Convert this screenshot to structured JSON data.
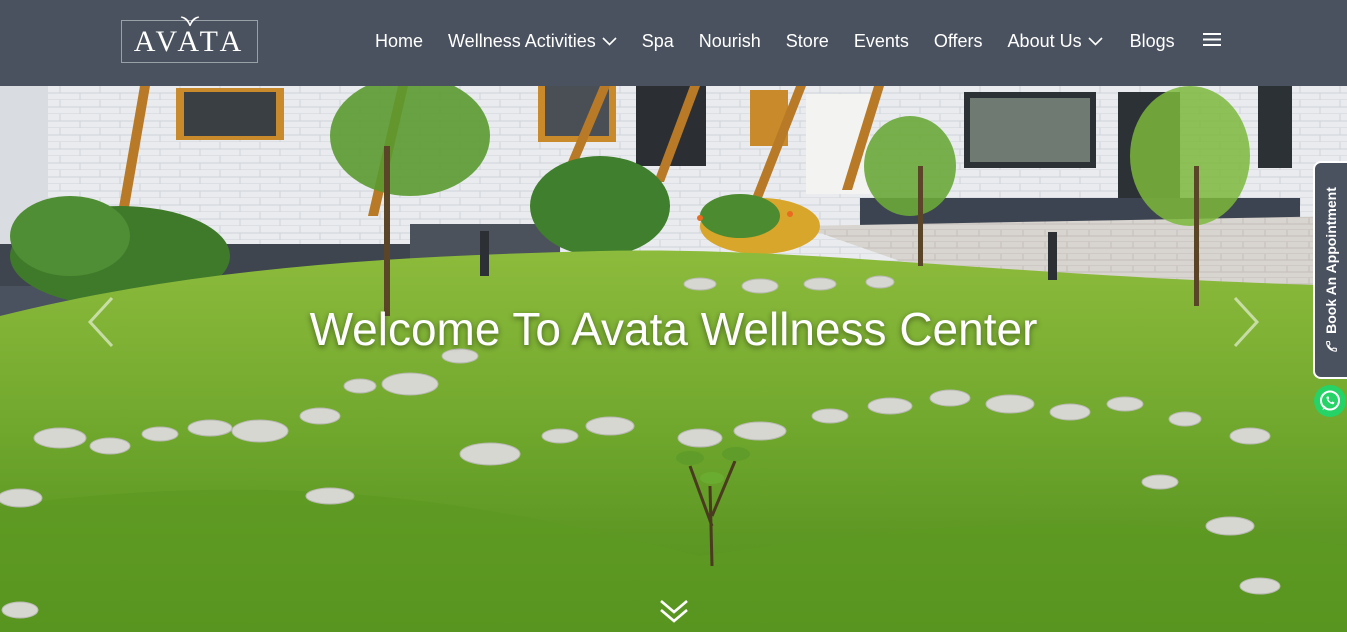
{
  "brand": {
    "logo_text": "AVATA"
  },
  "nav": {
    "items": [
      {
        "label": "Home",
        "has_dropdown": false
      },
      {
        "label": "Wellness Activities",
        "has_dropdown": true
      },
      {
        "label": "Spa",
        "has_dropdown": false
      },
      {
        "label": "Nourish",
        "has_dropdown": false
      },
      {
        "label": "Store",
        "has_dropdown": false
      },
      {
        "label": "Events",
        "has_dropdown": false
      },
      {
        "label": "Offers",
        "has_dropdown": false
      },
      {
        "label": "About Us",
        "has_dropdown": true
      },
      {
        "label": "Blogs",
        "has_dropdown": false
      }
    ],
    "menu_icon": "hamburger-icon"
  },
  "hero": {
    "title": "Welcome To Avata Wellness Center",
    "prev_icon": "chevron-left-icon",
    "next_icon": "chevron-right-icon",
    "scroll_icon": "double-chevron-down-icon"
  },
  "side": {
    "book_label": "Book An Appointment",
    "book_icon": "phone-icon",
    "whatsapp_icon": "whatsapp-icon"
  },
  "colors": {
    "header_bg": "#4a525f",
    "text": "#ffffff",
    "whatsapp": "#25d366"
  }
}
